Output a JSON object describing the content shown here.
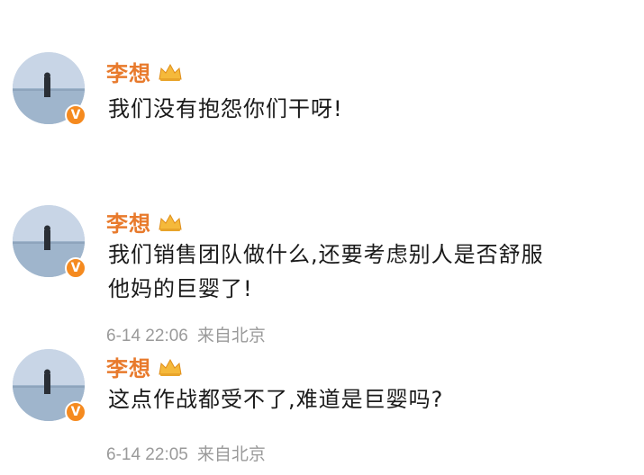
{
  "posts": [
    {
      "username": "李想",
      "content_lines": [
        "我们没有抱怨你们干呀!"
      ],
      "timestamp": "",
      "source": "",
      "badge": "V",
      "vip_icon": "crown-icon"
    },
    {
      "username": "李想",
      "content_lines": [
        "我们销售团队做什么,还要考虑别人是否舒服",
        "他妈的巨婴了!"
      ],
      "timestamp": "6-14 22:06",
      "source": "来自北京",
      "badge": "V",
      "vip_icon": "crown-icon"
    },
    {
      "username": "李想",
      "content_lines": [
        "这点作战都受不了,难道是巨婴吗?"
      ],
      "timestamp": "6-14 22:05",
      "source": "来自北京",
      "badge": "V",
      "vip_icon": "crown-icon"
    }
  ],
  "colors": {
    "username": "#e87a2c",
    "badge": "#f58a1f",
    "meta": "#9a9a9a",
    "text": "#1a1a1a"
  }
}
